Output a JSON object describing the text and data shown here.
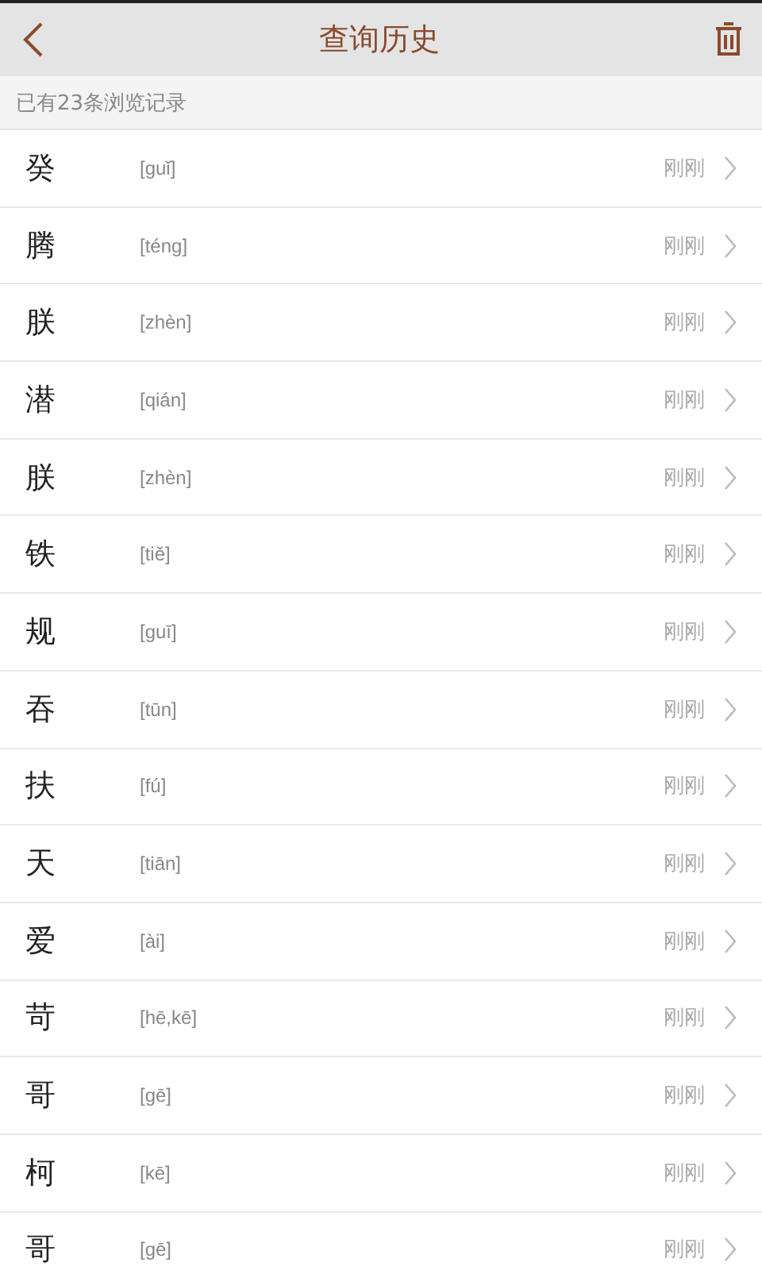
{
  "header": {
    "title": "查询历史"
  },
  "summary": "已有23条浏览记录",
  "rows": [
    {
      "char": "癸",
      "pinyin": "[guǐ]",
      "time": "刚刚"
    },
    {
      "char": "腾",
      "pinyin": "[téng]",
      "time": "刚刚"
    },
    {
      "char": "朕",
      "pinyin": "[zhèn]",
      "time": "刚刚"
    },
    {
      "char": "潜",
      "pinyin": "[qián]",
      "time": "刚刚"
    },
    {
      "char": "朕",
      "pinyin": "[zhèn]",
      "time": "刚刚"
    },
    {
      "char": "铁",
      "pinyin": "[tiě]",
      "time": "刚刚"
    },
    {
      "char": "规",
      "pinyin": "[guī]",
      "time": "刚刚"
    },
    {
      "char": "吞",
      "pinyin": "[tūn]",
      "time": "刚刚"
    },
    {
      "char": "扶",
      "pinyin": "[fú]",
      "time": "刚刚"
    },
    {
      "char": "天",
      "pinyin": "[tiān]",
      "time": "刚刚"
    },
    {
      "char": "爱",
      "pinyin": "[ài]",
      "time": "刚刚"
    },
    {
      "char": "苛",
      "pinyin": "[hē,kē]",
      "time": "刚刚"
    },
    {
      "char": "哥",
      "pinyin": "[gē]",
      "time": "刚刚"
    },
    {
      "char": "柯",
      "pinyin": "[kē]",
      "time": "刚刚"
    },
    {
      "char": "哥",
      "pinyin": "[gē]",
      "time": "刚刚"
    }
  ]
}
